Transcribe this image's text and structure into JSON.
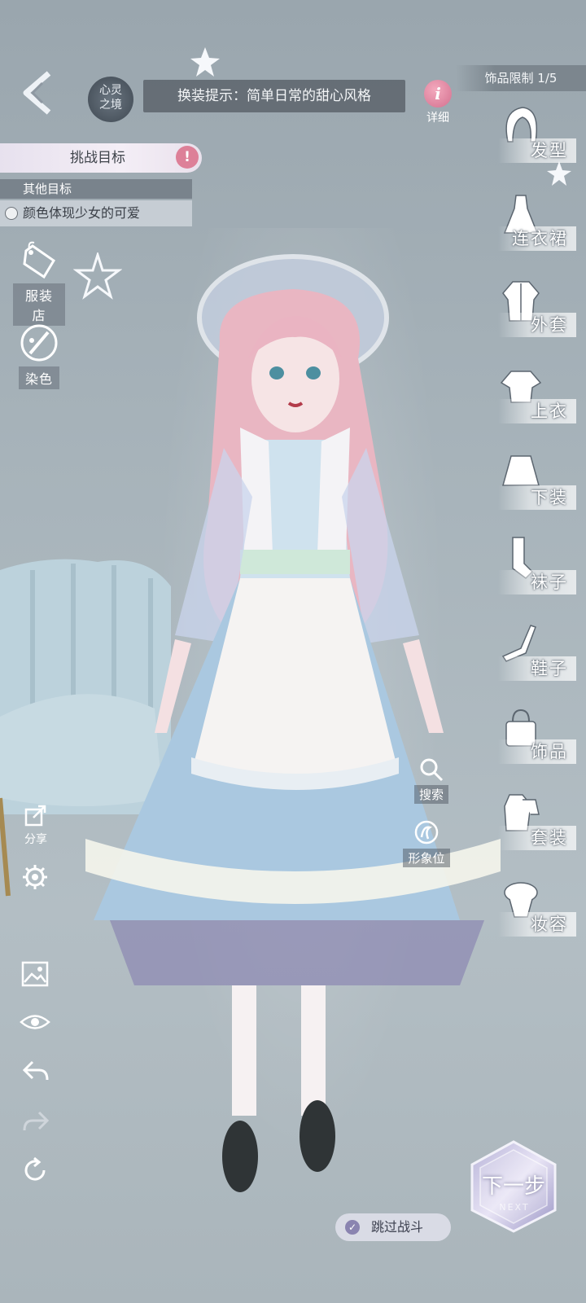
{
  "header": {
    "logo_text_line1": "心灵",
    "logo_text_line2": "之境",
    "hint": "换装提示：简单日常的甜心风格",
    "detail_icon_letter": "i",
    "detail_label": "详细",
    "accessory_limit": "饰品限制 1/5"
  },
  "challenge": {
    "title": "挑战目标",
    "warn_symbol": "!",
    "other_goals_label": "其他目标",
    "goals": [
      "颜色体现少女的可爱"
    ]
  },
  "left_tools": {
    "shop_label": "服装店",
    "dye_label": "染色",
    "share_label": "分享"
  },
  "categories": [
    {
      "label": "发型",
      "icon": "hair-icon"
    },
    {
      "label": "连衣裙",
      "icon": "dress-icon"
    },
    {
      "label": "外套",
      "icon": "coat-icon"
    },
    {
      "label": "上衣",
      "icon": "top-icon"
    },
    {
      "label": "下装",
      "icon": "skirt-icon"
    },
    {
      "label": "袜子",
      "icon": "socks-icon"
    },
    {
      "label": "鞋子",
      "icon": "shoes-icon"
    },
    {
      "label": "饰品",
      "icon": "bag-icon"
    },
    {
      "label": "套装",
      "icon": "suit-icon"
    },
    {
      "label": "妆容",
      "icon": "makeup-icon"
    }
  ],
  "actions": {
    "search_label": "搜索",
    "image_pos_label": "形象位",
    "next_label": "下一步",
    "next_sub": "NEXT",
    "skip_label": "跳过战斗"
  },
  "colors": {
    "accent_pink": "#dd8098",
    "background": "#a7b3ba"
  }
}
